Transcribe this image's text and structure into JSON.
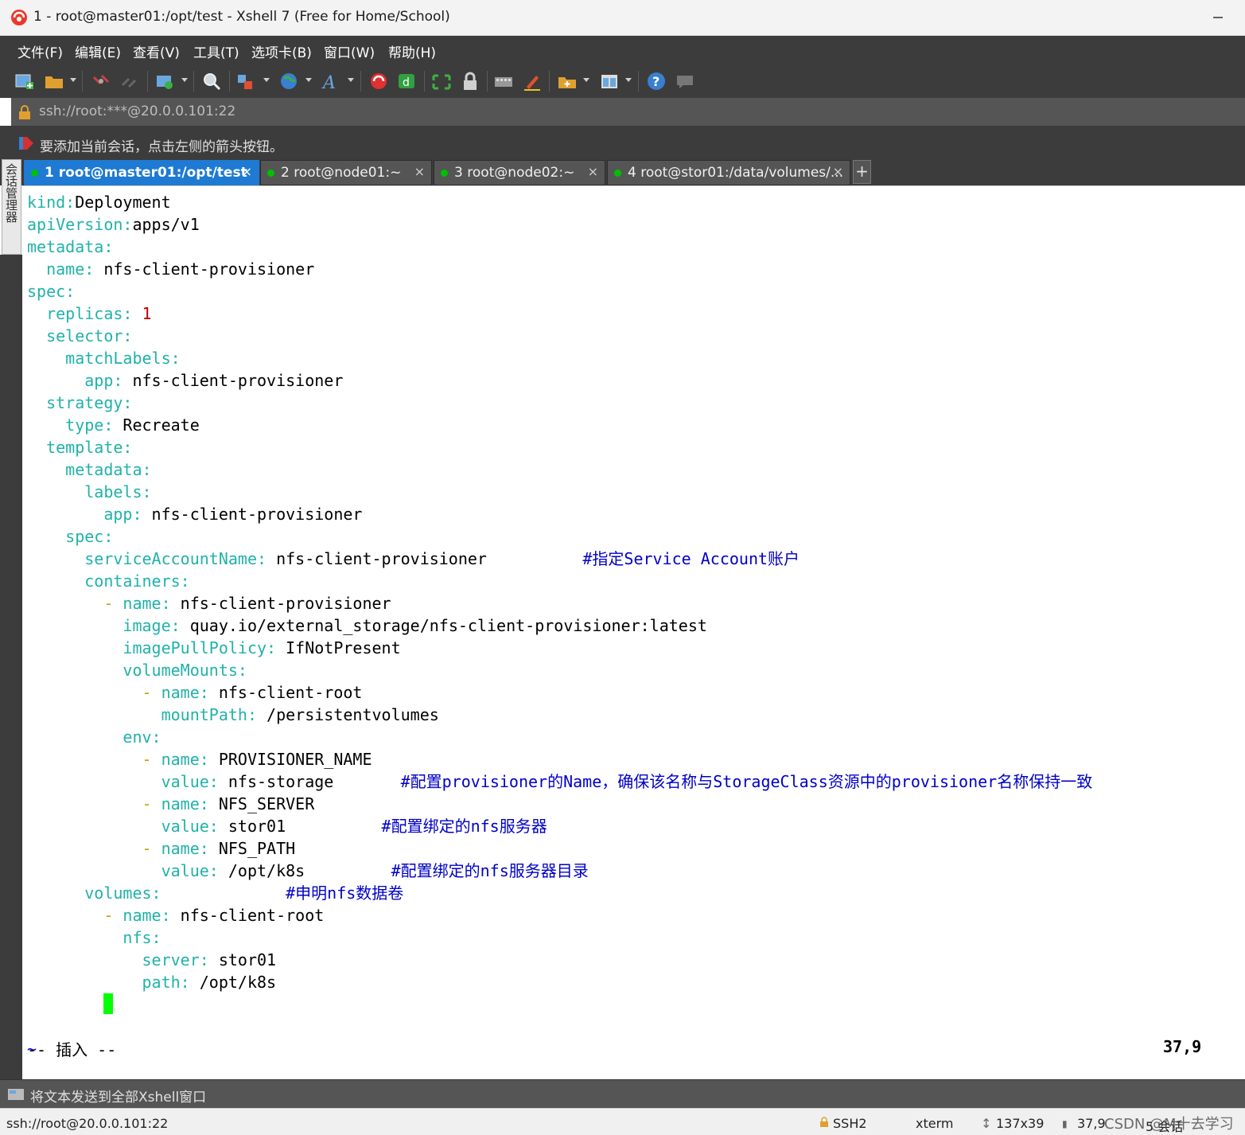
{
  "window": {
    "title": "1 - root@master01:/opt/test - Xshell 7 (Free for Home/School)"
  },
  "menu": [
    "文件(F)",
    "编辑(E)",
    "查看(V)",
    "工具(T)",
    "选项卡(B)",
    "窗口(W)",
    "帮助(H)"
  ],
  "address": "ssh://root:***@20.0.0.101:22",
  "hint": "要添加当前会话，点击左侧的箭头按钮。",
  "side_manager": "会话管理器",
  "tabs": [
    {
      "label": "1 root@master01:/opt/test",
      "active": true,
      "close": "×"
    },
    {
      "label": "2 root@node01:~",
      "active": false,
      "close": "×"
    },
    {
      "label": "3 root@node02:~",
      "active": false,
      "close": "×"
    },
    {
      "label": "4 root@stor01:/data/volumes/...",
      "active": false,
      "close": "×"
    }
  ],
  "tab_add": "+",
  "terminal": {
    "lines": [
      [
        [
          "k",
          "kind:"
        ],
        [
          "",
          "Deployment"
        ]
      ],
      [
        [
          "k",
          "apiVersion:"
        ],
        [
          "",
          "apps/v1"
        ]
      ],
      [
        [
          "k",
          "metadata:"
        ]
      ],
      [
        [
          "",
          "  "
        ],
        [
          "k",
          "name:"
        ],
        [
          "",
          " nfs-client-provisioner"
        ]
      ],
      [
        [
          "k",
          "spec:"
        ]
      ],
      [
        [
          "",
          "  "
        ],
        [
          "k",
          "replicas:"
        ],
        [
          "",
          " "
        ],
        [
          "n",
          "1"
        ]
      ],
      [
        [
          "",
          "  "
        ],
        [
          "k",
          "selector:"
        ]
      ],
      [
        [
          "",
          "    "
        ],
        [
          "k",
          "matchLabels:"
        ]
      ],
      [
        [
          "",
          "      "
        ],
        [
          "k",
          "app:"
        ],
        [
          "",
          " nfs-client-provisioner"
        ]
      ],
      [
        [
          "",
          "  "
        ],
        [
          "k",
          "strategy:"
        ]
      ],
      [
        [
          "",
          "    "
        ],
        [
          "k",
          "type:"
        ],
        [
          "",
          " Recreate"
        ]
      ],
      [
        [
          "",
          "  "
        ],
        [
          "k",
          "template:"
        ]
      ],
      [
        [
          "",
          "    "
        ],
        [
          "k",
          "metadata:"
        ]
      ],
      [
        [
          "",
          "      "
        ],
        [
          "k",
          "labels:"
        ]
      ],
      [
        [
          "",
          "        "
        ],
        [
          "k",
          "app:"
        ],
        [
          "",
          " nfs-client-provisioner"
        ]
      ],
      [
        [
          "",
          "    "
        ],
        [
          "k",
          "spec:"
        ]
      ],
      [
        [
          "",
          "      "
        ],
        [
          "k",
          "serviceAccountName:"
        ],
        [
          "",
          " nfs-client-provisioner          "
        ],
        [
          "c",
          "#指定Service Account账户"
        ]
      ],
      [
        [
          "",
          "      "
        ],
        [
          "k",
          "containers:"
        ]
      ],
      [
        [
          "",
          "        "
        ],
        [
          "d",
          "-"
        ],
        [
          "",
          " "
        ],
        [
          "k",
          "name:"
        ],
        [
          "",
          " nfs-client-provisioner"
        ]
      ],
      [
        [
          "",
          "          "
        ],
        [
          "k",
          "image:"
        ],
        [
          "",
          " quay.io/external_storage/nfs-client-provisioner:latest"
        ]
      ],
      [
        [
          "",
          "          "
        ],
        [
          "k",
          "imagePullPolicy:"
        ],
        [
          "",
          " IfNotPresent"
        ]
      ],
      [
        [
          "",
          "          "
        ],
        [
          "k",
          "volumeMounts:"
        ]
      ],
      [
        [
          "",
          "            "
        ],
        [
          "d",
          "-"
        ],
        [
          "",
          " "
        ],
        [
          "k",
          "name:"
        ],
        [
          "",
          " nfs-client-root"
        ]
      ],
      [
        [
          "",
          "              "
        ],
        [
          "k",
          "mountPath:"
        ],
        [
          "",
          " /persistentvolumes"
        ]
      ],
      [
        [
          "",
          "          "
        ],
        [
          "k",
          "env:"
        ]
      ],
      [
        [
          "",
          "            "
        ],
        [
          "d",
          "-"
        ],
        [
          "",
          " "
        ],
        [
          "k",
          "name:"
        ],
        [
          "",
          " PROVISIONER_NAME"
        ]
      ],
      [
        [
          "",
          "              "
        ],
        [
          "k",
          "value:"
        ],
        [
          "",
          " nfs-storage       "
        ],
        [
          "c",
          "#配置provisioner的Name，确保该名称与StorageClass资源中的provisioner名称保持一致"
        ]
      ],
      [
        [
          "",
          "            "
        ],
        [
          "d",
          "-"
        ],
        [
          "",
          " "
        ],
        [
          "k",
          "name:"
        ],
        [
          "",
          " NFS_SERVER"
        ]
      ],
      [
        [
          "",
          "              "
        ],
        [
          "k",
          "value:"
        ],
        [
          "",
          " stor01          "
        ],
        [
          "c",
          "#配置绑定的nfs服务器"
        ]
      ],
      [
        [
          "",
          "            "
        ],
        [
          "d",
          "-"
        ],
        [
          "",
          " "
        ],
        [
          "k",
          "name:"
        ],
        [
          "",
          " NFS_PATH"
        ]
      ],
      [
        [
          "",
          "              "
        ],
        [
          "k",
          "value:"
        ],
        [
          "",
          " /opt/k8s         "
        ],
        [
          "c",
          "#配置绑定的nfs服务器目录"
        ]
      ],
      [
        [
          "",
          "      "
        ],
        [
          "k",
          "volumes:"
        ],
        [
          "",
          "             "
        ],
        [
          "c",
          "#申明nfs数据卷"
        ]
      ],
      [
        [
          "",
          "        "
        ],
        [
          "d",
          "-"
        ],
        [
          "",
          " "
        ],
        [
          "k",
          "name:"
        ],
        [
          "",
          " nfs-client-root"
        ]
      ],
      [
        [
          "",
          "          "
        ],
        [
          "k",
          "nfs:"
        ]
      ],
      [
        [
          "",
          "            "
        ],
        [
          "k",
          "server:"
        ],
        [
          "",
          " stor01"
        ]
      ],
      [
        [
          "",
          "            "
        ],
        [
          "k",
          "path:"
        ],
        [
          "",
          " /opt/k8s"
        ]
      ],
      [],
      [],
      [
        [
          "c",
          "~"
        ]
      ]
    ],
    "mode": "-- 插入 --",
    "position": "37,9"
  },
  "send_bar": "将文本发送到全部Xshell窗口",
  "status": {
    "connection": "ssh://root@20.0.0.101:22",
    "protocol": "SSH2",
    "terminal_type": "xterm",
    "size": "137x39",
    "cursor": "37,9",
    "watermark": "CSDN @M十去学习",
    "sessions": "5 会话"
  },
  "colors": {
    "key": "#20b2aa",
    "comment": "#0000c8",
    "number": "#c00000",
    "dash": "#c8a000",
    "cursor": "#00ff00",
    "active_tab": "#1e7ad2"
  }
}
